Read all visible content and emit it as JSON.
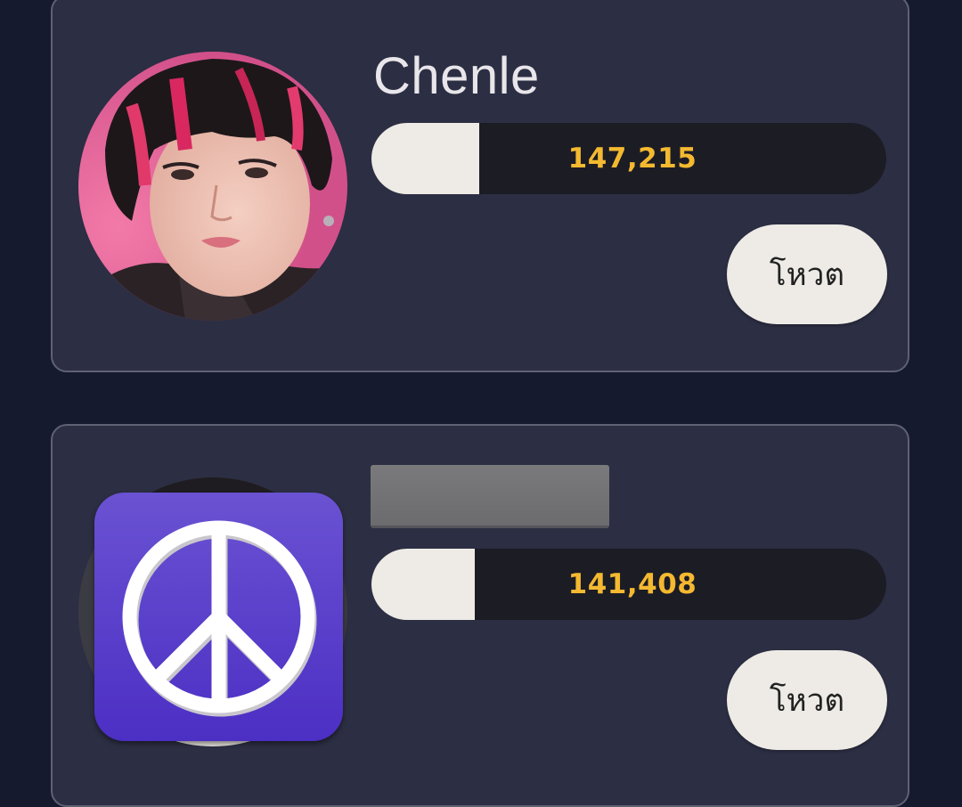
{
  "candidates": [
    {
      "name": "Chenle",
      "votes": "147,215",
      "vote_share": 0.21,
      "vote_button": "โหวต"
    },
    {
      "name": "",
      "votes": "141,408",
      "vote_share": 0.2,
      "vote_button": "โหวต",
      "icon": "peace-sign-icon"
    }
  ],
  "colors": {
    "page_background": "#161a2e",
    "card_background": "#2c2e43",
    "vote_count": "#f4b930",
    "bar_fill": "#eeebe6",
    "bar_track": "#1c1c25",
    "icon_purple": "#5b3fcb"
  }
}
